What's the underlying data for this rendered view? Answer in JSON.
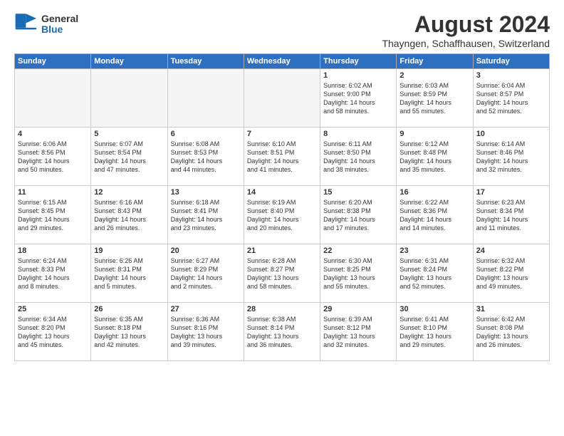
{
  "logo": {
    "general": "General",
    "blue": "Blue"
  },
  "title": "August 2024",
  "location": "Thayngen, Schaffhausen, Switzerland",
  "days_of_week": [
    "Sunday",
    "Monday",
    "Tuesday",
    "Wednesday",
    "Thursday",
    "Friday",
    "Saturday"
  ],
  "weeks": [
    [
      {
        "day": "",
        "info": ""
      },
      {
        "day": "",
        "info": ""
      },
      {
        "day": "",
        "info": ""
      },
      {
        "day": "",
        "info": ""
      },
      {
        "day": "1",
        "info": "Sunrise: 6:02 AM\nSunset: 9:00 PM\nDaylight: 14 hours\nand 58 minutes."
      },
      {
        "day": "2",
        "info": "Sunrise: 6:03 AM\nSunset: 8:59 PM\nDaylight: 14 hours\nand 55 minutes."
      },
      {
        "day": "3",
        "info": "Sunrise: 6:04 AM\nSunset: 8:57 PM\nDaylight: 14 hours\nand 52 minutes."
      }
    ],
    [
      {
        "day": "4",
        "info": "Sunrise: 6:06 AM\nSunset: 8:56 PM\nDaylight: 14 hours\nand 50 minutes."
      },
      {
        "day": "5",
        "info": "Sunrise: 6:07 AM\nSunset: 8:54 PM\nDaylight: 14 hours\nand 47 minutes."
      },
      {
        "day": "6",
        "info": "Sunrise: 6:08 AM\nSunset: 8:53 PM\nDaylight: 14 hours\nand 44 minutes."
      },
      {
        "day": "7",
        "info": "Sunrise: 6:10 AM\nSunset: 8:51 PM\nDaylight: 14 hours\nand 41 minutes."
      },
      {
        "day": "8",
        "info": "Sunrise: 6:11 AM\nSunset: 8:50 PM\nDaylight: 14 hours\nand 38 minutes."
      },
      {
        "day": "9",
        "info": "Sunrise: 6:12 AM\nSunset: 8:48 PM\nDaylight: 14 hours\nand 35 minutes."
      },
      {
        "day": "10",
        "info": "Sunrise: 6:14 AM\nSunset: 8:46 PM\nDaylight: 14 hours\nand 32 minutes."
      }
    ],
    [
      {
        "day": "11",
        "info": "Sunrise: 6:15 AM\nSunset: 8:45 PM\nDaylight: 14 hours\nand 29 minutes."
      },
      {
        "day": "12",
        "info": "Sunrise: 6:16 AM\nSunset: 8:43 PM\nDaylight: 14 hours\nand 26 minutes."
      },
      {
        "day": "13",
        "info": "Sunrise: 6:18 AM\nSunset: 8:41 PM\nDaylight: 14 hours\nand 23 minutes."
      },
      {
        "day": "14",
        "info": "Sunrise: 6:19 AM\nSunset: 8:40 PM\nDaylight: 14 hours\nand 20 minutes."
      },
      {
        "day": "15",
        "info": "Sunrise: 6:20 AM\nSunset: 8:38 PM\nDaylight: 14 hours\nand 17 minutes."
      },
      {
        "day": "16",
        "info": "Sunrise: 6:22 AM\nSunset: 8:36 PM\nDaylight: 14 hours\nand 14 minutes."
      },
      {
        "day": "17",
        "info": "Sunrise: 6:23 AM\nSunset: 8:34 PM\nDaylight: 14 hours\nand 11 minutes."
      }
    ],
    [
      {
        "day": "18",
        "info": "Sunrise: 6:24 AM\nSunset: 8:33 PM\nDaylight: 14 hours\nand 8 minutes."
      },
      {
        "day": "19",
        "info": "Sunrise: 6:26 AM\nSunset: 8:31 PM\nDaylight: 14 hours\nand 5 minutes."
      },
      {
        "day": "20",
        "info": "Sunrise: 6:27 AM\nSunset: 8:29 PM\nDaylight: 14 hours\nand 2 minutes."
      },
      {
        "day": "21",
        "info": "Sunrise: 6:28 AM\nSunset: 8:27 PM\nDaylight: 13 hours\nand 58 minutes."
      },
      {
        "day": "22",
        "info": "Sunrise: 6:30 AM\nSunset: 8:25 PM\nDaylight: 13 hours\nand 55 minutes."
      },
      {
        "day": "23",
        "info": "Sunrise: 6:31 AM\nSunset: 8:24 PM\nDaylight: 13 hours\nand 52 minutes."
      },
      {
        "day": "24",
        "info": "Sunrise: 6:32 AM\nSunset: 8:22 PM\nDaylight: 13 hours\nand 49 minutes."
      }
    ],
    [
      {
        "day": "25",
        "info": "Sunrise: 6:34 AM\nSunset: 8:20 PM\nDaylight: 13 hours\nand 45 minutes."
      },
      {
        "day": "26",
        "info": "Sunrise: 6:35 AM\nSunset: 8:18 PM\nDaylight: 13 hours\nand 42 minutes."
      },
      {
        "day": "27",
        "info": "Sunrise: 6:36 AM\nSunset: 8:16 PM\nDaylight: 13 hours\nand 39 minutes."
      },
      {
        "day": "28",
        "info": "Sunrise: 6:38 AM\nSunset: 8:14 PM\nDaylight: 13 hours\nand 36 minutes."
      },
      {
        "day": "29",
        "info": "Sunrise: 6:39 AM\nSunset: 8:12 PM\nDaylight: 13 hours\nand 32 minutes."
      },
      {
        "day": "30",
        "info": "Sunrise: 6:41 AM\nSunset: 8:10 PM\nDaylight: 13 hours\nand 29 minutes."
      },
      {
        "day": "31",
        "info": "Sunrise: 6:42 AM\nSunset: 8:08 PM\nDaylight: 13 hours\nand 26 minutes."
      }
    ]
  ]
}
